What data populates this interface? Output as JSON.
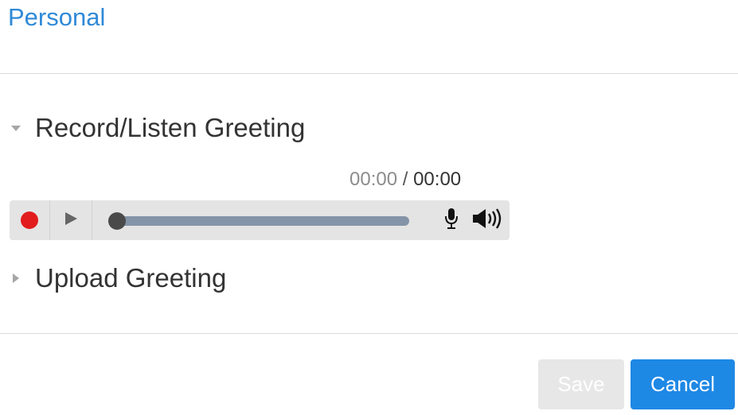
{
  "header": {
    "tab_title": "Personal"
  },
  "sections": {
    "record": {
      "label": "Record/Listen Greeting",
      "caret_icon": "caret-down-icon",
      "expanded": true
    },
    "upload": {
      "label": "Upload Greeting",
      "caret_icon": "caret-right-icon",
      "expanded": false
    }
  },
  "player": {
    "current_time": "00:00",
    "separator": "/",
    "total_time": "00:00",
    "progress": 0,
    "icons": {
      "record": "record-icon",
      "play": "play-icon",
      "microphone": "microphone-icon",
      "volume": "speaker-volume-icon"
    }
  },
  "footer": {
    "save_label": "Save",
    "cancel_label": "Cancel",
    "save_enabled": false
  },
  "colors": {
    "tab_title": "#2f8ad8",
    "record": "#e21c1c",
    "progress_track": "#8494a8",
    "cancel_button": "#1e88e5",
    "save_button_disabled": "#e7e7e7"
  }
}
